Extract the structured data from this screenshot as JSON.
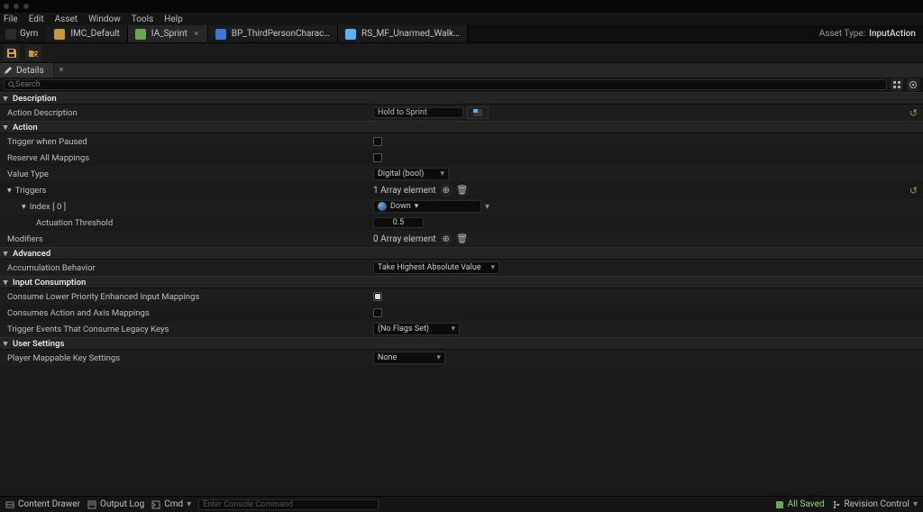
{
  "menu": {
    "file": "File",
    "edit": "Edit",
    "asset": "Asset",
    "window": "Window",
    "tools": "Tools",
    "help": "Help"
  },
  "project": {
    "name": "Gym"
  },
  "tabs": [
    {
      "label": "IMC_Default",
      "icon": "#c79a3b",
      "active": false,
      "closable": false
    },
    {
      "label": "IA_Sprint",
      "icon": "#6aa84f",
      "active": true,
      "closable": true
    },
    {
      "label": "BP_ThirdPersonCharac…",
      "icon": "#3c78d8",
      "active": false,
      "closable": false
    },
    {
      "label": "RS_MF_Unarmed_Walk…",
      "icon": "#5caeff",
      "active": false,
      "closable": false
    }
  ],
  "assettype": {
    "label": "Asset Type:",
    "value": "InputAction"
  },
  "details": {
    "title": "Details"
  },
  "search": {
    "placeholder": "Search"
  },
  "categories": {
    "description": {
      "title": "Description",
      "action_description": {
        "label": "Action Description",
        "value": "Hold to Sprint",
        "extra_icon": true
      }
    },
    "action": {
      "title": "Action",
      "trigger_when_paused": {
        "label": "Trigger when Paused",
        "value": false
      },
      "reserve_all_mappings": {
        "label": "Reserve All Mappings",
        "value": false
      },
      "value_type": {
        "label": "Value Type",
        "value": "Digital (bool)"
      },
      "triggers": {
        "label": "Triggers",
        "summary": "1 Array element",
        "items": [
          {
            "index_label": "Index [ 0 ]",
            "kind": "Down",
            "actuation": {
              "label": "Actuation Threshold",
              "value": "0.5"
            }
          }
        ]
      },
      "modifiers": {
        "label": "Modifiers",
        "summary": "0 Array element"
      }
    },
    "advanced": {
      "title": "Advanced",
      "accumulation": {
        "label": "Accumulation Behavior",
        "value": "Take Highest Absolute Value"
      }
    },
    "input_consumption": {
      "title": "Input Consumption",
      "consume_lower": {
        "label": "Consume Lower Priority Enhanced Input Mappings",
        "value": true
      },
      "consumes_legacy": {
        "label": "Consumes Action and Axis Mappings",
        "value": false
      },
      "legacy_keys": {
        "label": "Trigger Events That Consume Legacy Keys",
        "value": "(No Flags Set)"
      }
    },
    "user_settings": {
      "title": "User Settings",
      "player_mappable": {
        "label": "Player Mappable Key Settings",
        "value": "None"
      }
    }
  },
  "status": {
    "content_drawer": "Content Drawer",
    "output_log": "Output Log",
    "cmd_label": "Cmd",
    "cmd_placeholder": "Enter Console Command",
    "all_saved": "All Saved",
    "revision": "Revision Control"
  }
}
